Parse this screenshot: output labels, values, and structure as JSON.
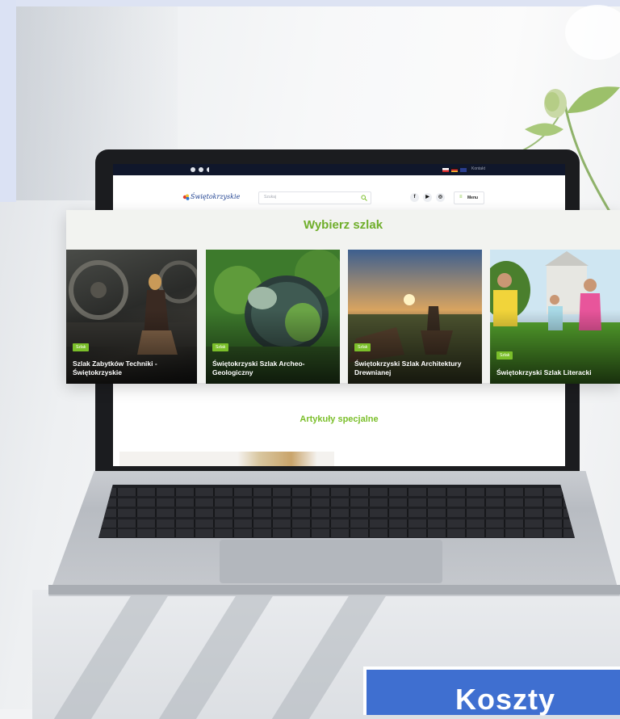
{
  "site": {
    "logo_text": "Świętokrzyskie",
    "search_placeholder": "Szukaj",
    "menu_label": "Menu",
    "top_link": "Kontakt",
    "social": [
      "f",
      "▶",
      "◎"
    ],
    "accent_color": "#7bbf2a"
  },
  "trails": {
    "heading": "Wybierz szlak",
    "cards": [
      {
        "badge": "Szlak",
        "title": "Szlak Zabytków Techniki - Świętokrzyskie"
      },
      {
        "badge": "Szlak",
        "title": "Świętokrzyski Szlak Archeo-Geologiczny"
      },
      {
        "badge": "Szlak",
        "title": "Świętokrzyski Szlak Architektury Drewnianej"
      },
      {
        "badge": "Szlak",
        "title": "Świętokrzyski Szlak Literacki"
      }
    ]
  },
  "articles": {
    "heading": "Artykuły specjalne"
  },
  "footer_box": {
    "label": "Koszty",
    "color": "#3f6fd0"
  }
}
